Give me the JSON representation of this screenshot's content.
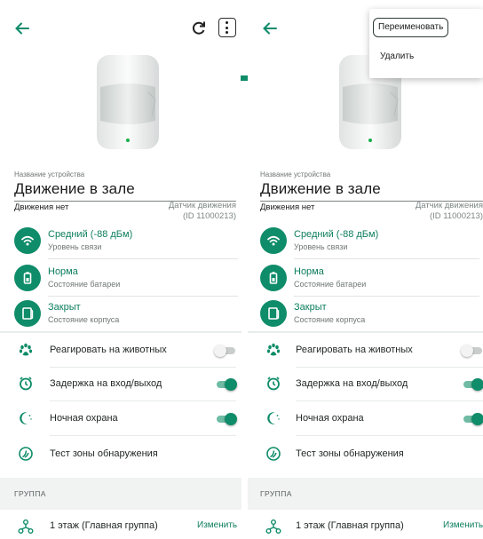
{
  "device": {
    "name_label": "Название устройства",
    "name": "Движение в зале",
    "status": "Движения нет",
    "type": "Датчик движения",
    "id": "(ID 11000213)"
  },
  "stats": [
    {
      "value": "Средний (-88 дБм)",
      "sub": "Уровень связи",
      "icon": "wifi-icon"
    },
    {
      "value": "Норма",
      "sub": "Состояние батареи",
      "icon": "battery-icon"
    },
    {
      "value": "Закрыт",
      "sub": "Состояние корпуса",
      "icon": "case-icon"
    }
  ],
  "settings": [
    {
      "label": "Реагировать на животных",
      "icon": "paw-icon",
      "toggle": false
    },
    {
      "label": "Задержка на вход/выход",
      "icon": "delay-timer-icon",
      "toggle": true
    },
    {
      "label": "Ночная охрана",
      "icon": "night-moon-icon",
      "toggle": true
    },
    {
      "label": "Тест зоны обнаружения",
      "icon": "detection-test-icon"
    }
  ],
  "group": {
    "header": "ГРУППА",
    "name": "1 этаж (Главная группа)",
    "action": "Изменить"
  },
  "menu": {
    "rename": "Переименовать",
    "delete": "Удалить"
  },
  "colors": {
    "accent": "#0f8c69"
  }
}
